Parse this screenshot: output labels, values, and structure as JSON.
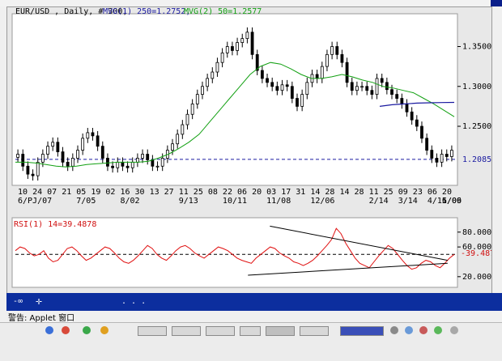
{
  "chart_data": [
    {
      "type": "candlestick",
      "title": "EUR/USD , Daily, # 300,",
      "legend": [
        {
          "label": "MVG(1) 250=1.2752,",
          "color": "#1a1aa0"
        },
        {
          "label": "MVG(2) 50=1.2577",
          "color": "#12a012"
        }
      ],
      "ylim": [
        1.18,
        1.385
      ],
      "yticks": [
        "1.3500",
        "1.3000",
        "1.2500"
      ],
      "reference_line": {
        "value": 1.2085,
        "label": "1.2085",
        "style": "dashed"
      },
      "x_day_labels": [
        "10",
        "24",
        "07",
        "21",
        "05",
        "19",
        "02",
        "16",
        "30",
        "13",
        "27",
        "11",
        "25",
        "08",
        "22",
        "06",
        "20",
        "03",
        "17",
        "31",
        "14",
        "28",
        "14",
        "28",
        "11",
        "25",
        "09",
        "23",
        "06",
        "20"
      ],
      "x_date_labels": [
        "6/PJ/07",
        "7/05",
        "8/02",
        "9/13",
        "10/11",
        "11/08",
        "12/06",
        "2/14",
        "3/14",
        "4/11",
        "5/09",
        "6/06"
      ],
      "close": [
        1.215,
        1.2,
        1.19,
        1.188,
        1.205,
        1.215,
        1.225,
        1.23,
        1.218,
        1.205,
        1.2,
        1.21,
        1.22,
        1.235,
        1.242,
        1.238,
        1.225,
        1.21,
        1.2,
        1.198,
        1.205,
        1.2,
        1.198,
        1.205,
        1.21,
        1.215,
        1.208,
        1.2,
        1.2,
        1.21,
        1.22,
        1.228,
        1.24,
        1.252,
        1.265,
        1.278,
        1.29,
        1.3,
        1.31,
        1.318,
        1.33,
        1.342,
        1.35,
        1.345,
        1.355,
        1.36,
        1.368,
        1.34,
        1.32,
        1.31,
        1.305,
        1.3,
        1.295,
        1.302,
        1.3,
        1.285,
        1.275,
        1.29,
        1.305,
        1.315,
        1.31,
        1.325,
        1.34,
        1.35,
        1.34,
        1.33,
        1.305,
        1.295,
        1.3,
        1.3,
        1.295,
        1.29,
        1.31,
        1.305,
        1.296,
        1.29,
        1.285,
        1.278,
        1.268,
        1.258,
        1.25,
        1.235,
        1.22,
        1.21,
        1.205,
        1.215,
        1.212,
        1.22
      ],
      "ma_250": [
        1.275,
        1.277,
        1.278,
        1.279,
        1.2795,
        1.2798,
        1.28
      ],
      "ma_50": [
        1.205,
        1.205,
        1.204,
        1.202,
        1.2,
        1.199,
        1.2,
        1.202,
        1.203,
        1.204,
        1.205,
        1.205,
        1.205,
        1.206,
        1.21,
        1.215,
        1.222,
        1.23,
        1.24,
        1.255,
        1.27,
        1.285,
        1.3,
        1.315,
        1.325,
        1.33,
        1.328,
        1.322,
        1.315,
        1.31,
        1.31,
        1.312,
        1.315,
        1.312,
        1.308,
        1.305,
        1.3,
        1.298,
        1.295,
        1.292,
        1.285,
        1.278,
        1.27,
        1.262
      ]
    },
    {
      "type": "line",
      "title": "RSI(1) 14=39.4878",
      "ylim": [
        10,
        95
      ],
      "yticks": [
        "80.0000",
        "60.0000",
        "20.0000"
      ],
      "current_label": "39.4878",
      "dashed_level": 50,
      "values": [
        55,
        60,
        58,
        52,
        48,
        50,
        55,
        45,
        40,
        42,
        50,
        58,
        60,
        55,
        48,
        42,
        45,
        50,
        55,
        60,
        58,
        52,
        45,
        40,
        38,
        42,
        48,
        55,
        62,
        58,
        50,
        45,
        42,
        48,
        55,
        60,
        62,
        58,
        52,
        48,
        45,
        50,
        55,
        60,
        58,
        55,
        50,
        45,
        42,
        40,
        38,
        45,
        50,
        55,
        60,
        58,
        52,
        48,
        45,
        40,
        38,
        35,
        38,
        42,
        48,
        55,
        62,
        70,
        85,
        78,
        65,
        55,
        45,
        38,
        35,
        32,
        40,
        48,
        55,
        62,
        58,
        50,
        42,
        35,
        30,
        32,
        38,
        42,
        40,
        35,
        32,
        38,
        45,
        50
      ],
      "trendline_upper": [
        [
          0.58,
          88
        ],
        [
          0.985,
          42
        ]
      ],
      "trendline_lower": [
        [
          0.53,
          22
        ],
        [
          0.985,
          38
        ]
      ]
    }
  ],
  "toolbar": {
    "zoom_label": "-∞",
    "ellipsis": ". . ."
  },
  "status": {
    "text": "警告: Applet 窗口"
  }
}
